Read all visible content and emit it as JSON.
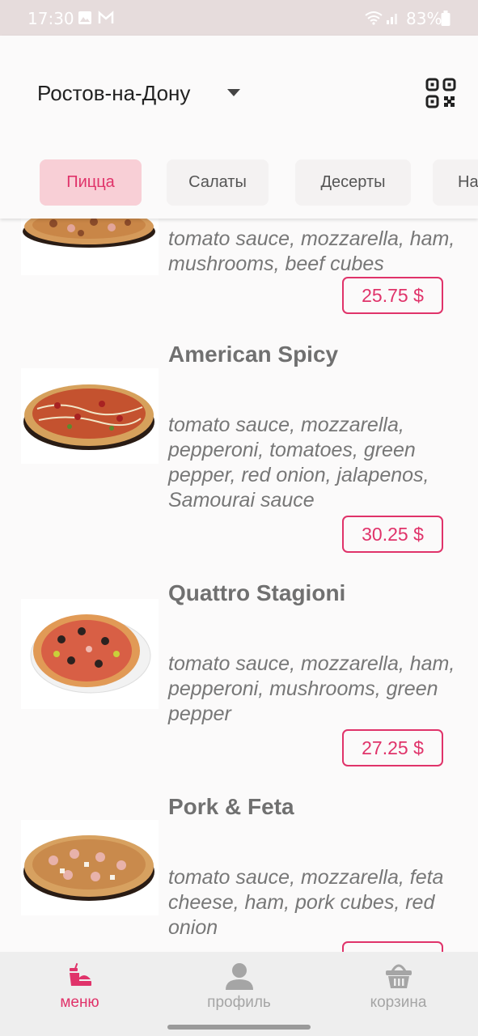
{
  "status_bar": {
    "time": "17:30",
    "battery": "83%"
  },
  "header": {
    "city": "Ростов-на-Дону"
  },
  "tabs": [
    {
      "label": "Пицца",
      "active": true
    },
    {
      "label": "Салаты",
      "active": false
    },
    {
      "label": "Десерты",
      "active": false
    },
    {
      "label": "На",
      "active": false
    }
  ],
  "items": [
    {
      "title": "",
      "desc": "tomato sauce, mozzarella, ham, mushrooms, beef cubes",
      "price": "25.75 $"
    },
    {
      "title": "American Spicy",
      "desc": "tomato sauce, mozzarella, pepperoni, tomatoes, green pepper, red onion, jalapenos, Samourai sauce",
      "price": "30.25 $"
    },
    {
      "title": "Quattro Stagioni",
      "desc": "tomato sauce, mozzarella, ham, pepperoni, mushrooms, green pepper",
      "price": "27.25 $"
    },
    {
      "title": "Pork & Feta",
      "desc": "tomato sauce, mozzarella, feta cheese, ham, pork cubes, red onion",
      "price": ""
    }
  ],
  "bottom_nav": [
    {
      "label": "меню",
      "icon": "food-tray-icon",
      "active": true
    },
    {
      "label": "профиль",
      "icon": "person-icon",
      "active": false
    },
    {
      "label": "корзина",
      "icon": "basket-icon",
      "active": false
    }
  ],
  "colors": {
    "accent": "#e0336a",
    "tab_active_bg": "#f8cfd6",
    "status_bar": "#e6dcdc"
  }
}
